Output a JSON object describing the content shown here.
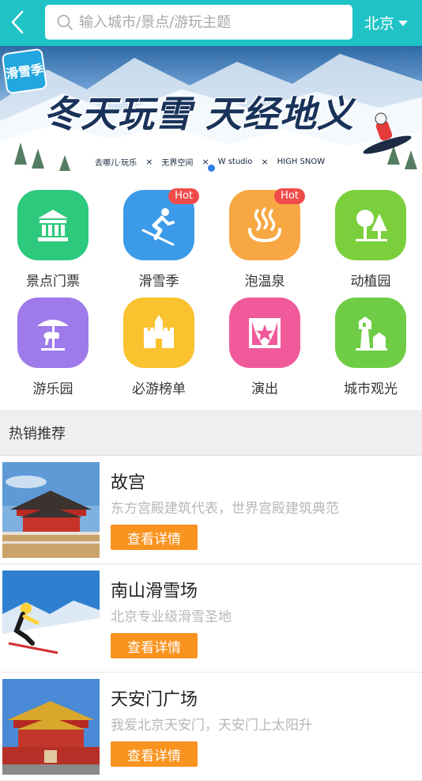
{
  "header": {
    "back_icon": "chevron-left-icon",
    "search_placeholder": "输入城市/景点/游玩主题",
    "search_value": "",
    "city": "北京",
    "bg_color": "#1fc3c6"
  },
  "banner": {
    "brand_text": "滑雪季",
    "slogan": "冬天玩雪 天经地义",
    "partners": [
      "去哪儿·玩乐",
      "无界空间",
      "W studio",
      "HIGH SNOW"
    ],
    "partner_separator": "×",
    "active_dot_color": "#2c7fe8"
  },
  "categories": [
    {
      "label": "景点门票",
      "icon": "temple-icon",
      "color": "#2dc97d",
      "hot": null
    },
    {
      "label": "滑雪季",
      "icon": "skier-icon",
      "color": "#3c9be8",
      "hot": "Hot"
    },
    {
      "label": "泡温泉",
      "icon": "hot-spring-icon",
      "color": "#f7a843",
      "hot": "Hot"
    },
    {
      "label": "动植园",
      "icon": "tree-icon",
      "color": "#7ccf3c",
      "hot": null
    },
    {
      "label": "游乐园",
      "icon": "carousel-icon",
      "color": "#9f7aea",
      "hot": null
    },
    {
      "label": "必游榜单",
      "icon": "castle-icon",
      "color": "#f9c22e",
      "hot": null
    },
    {
      "label": "演出",
      "icon": "stage-icon",
      "color": "#f05a9a",
      "hot": null
    },
    {
      "label": "城市观光",
      "icon": "tower-icon",
      "color": "#6fcd45",
      "hot": null
    }
  ],
  "section": {
    "title": "热销推荐"
  },
  "recommendations": [
    {
      "title": "故宫",
      "desc": "东方宫殿建筑代表，世界宫殿建筑典范",
      "button": "查看详情",
      "thumb": "palace-photo"
    },
    {
      "title": "南山滑雪场",
      "desc": "北京专业级滑雪圣地",
      "button": "查看详情",
      "thumb": "skier-photo"
    },
    {
      "title": "天安门广场",
      "desc": "我爱北京天安门，天安门上太阳升",
      "button": "查看详情",
      "thumb": "tiananmen-photo"
    }
  ],
  "colors": {
    "button_orange": "#f9931f",
    "hot_red": "#f04b4b",
    "section_bg": "#efefef"
  }
}
